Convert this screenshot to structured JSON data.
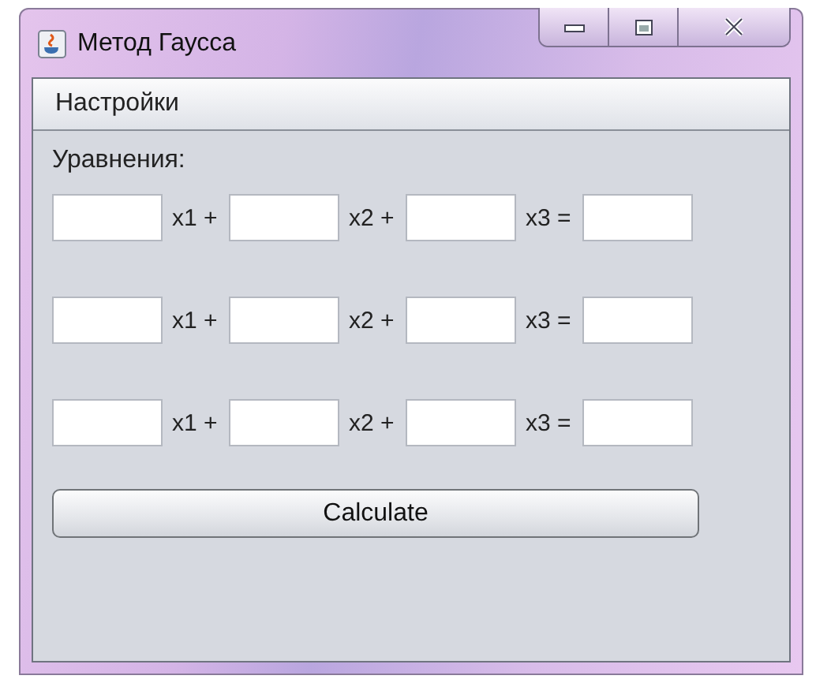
{
  "window": {
    "title": "Метод Гаусса"
  },
  "menu": [
    "Настройки"
  ],
  "equations_label": "Уравнения:",
  "equations": [
    {
      "labels": [
        "x1 +",
        "x2 +",
        "x3 ="
      ]
    },
    {
      "labels": [
        "x1 +",
        "x2 +",
        "x3 ="
      ]
    },
    {
      "labels": [
        "x1 +",
        "x2 +",
        "x3 ="
      ]
    }
  ],
  "button": "Calculate"
}
